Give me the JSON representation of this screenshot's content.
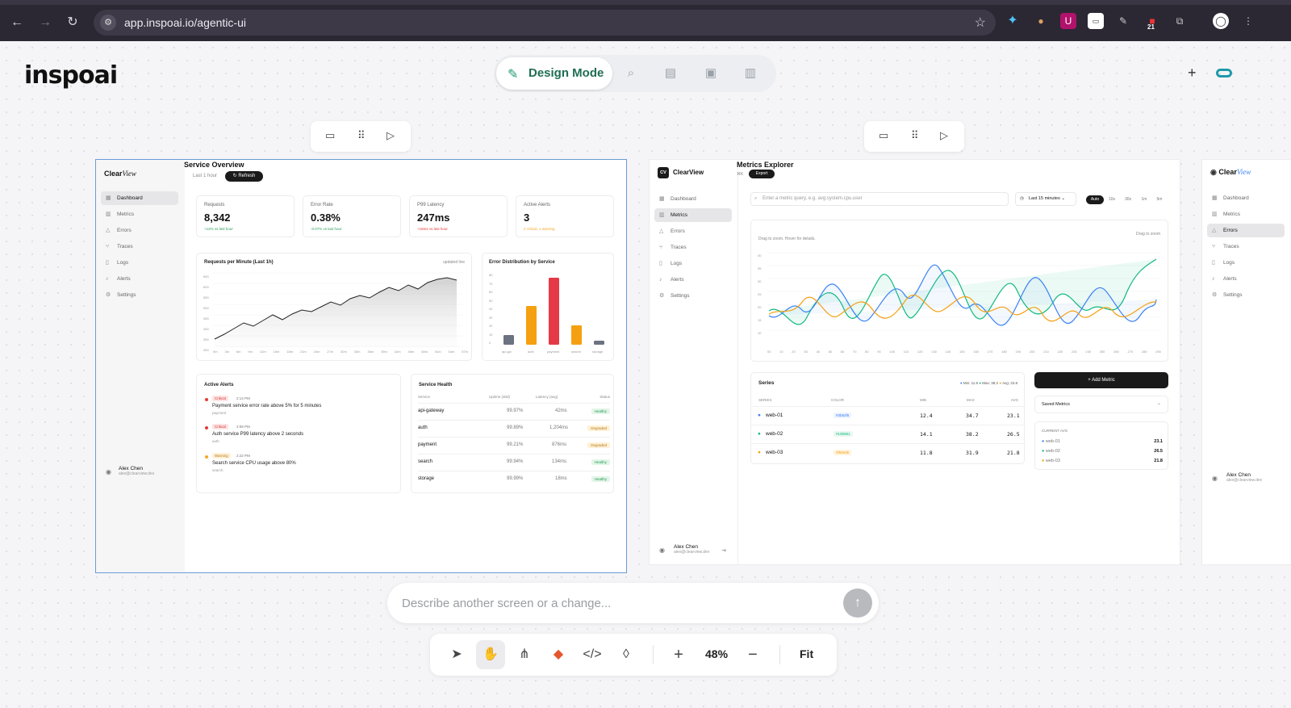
{
  "browser": {
    "url": "app.inspoai.io/agentic-ui",
    "extension_badge": "21"
  },
  "app": {
    "logo_text": "inspoai",
    "mode_label": "Design Mode",
    "mode_icons": [
      "search-icon",
      "layout-icon",
      "ai-icon",
      "trash-icon"
    ]
  },
  "colors": {
    "accent_green": "#1a9a6c",
    "selection_blue": "#6a9bd6",
    "critical": "#e53935",
    "warning": "#f5a623",
    "healthy": "#2e9e5b"
  },
  "screen1": {
    "brand": "Clear",
    "brand_italic": "View",
    "title": "Service Overview",
    "timerange": "Last 1 hour",
    "refresh_label": "Refresh",
    "nav": [
      "Dashboard",
      "Metrics",
      "Errors",
      "Traces",
      "Logs",
      "Alerts",
      "Settings"
    ],
    "kpis": [
      {
        "title": "Requests",
        "value": "8,342",
        "delta": "+12% vs last hour"
      },
      {
        "title": "Error Rate",
        "value": "0.38%",
        "delta": "-0.07% vs last hour"
      },
      {
        "title": "P99 Latency",
        "value": "247ms",
        "delta": "+18ms vs last hour"
      },
      {
        "title": "Active Alerts",
        "value": "3",
        "delta": "2 critical, 1 warning"
      }
    ],
    "rpm_chart": {
      "title": "Requests per Minute (Last 1h)",
      "badge": "updated live",
      "y_ticks": [
        "650",
        "600",
        "550",
        "500",
        "450",
        "400",
        "350",
        "300",
        "250"
      ],
      "x_ticks": [
        "0m",
        "3m",
        "6m",
        "9m",
        "12m",
        "15m",
        "18m",
        "21m",
        "24m",
        "27m",
        "30m",
        "33m",
        "36m",
        "39m",
        "42m",
        "45m",
        "48m",
        "51m",
        "54m",
        "57m"
      ]
    },
    "error_chart": {
      "title": "Error Distribution by Service",
      "y_ticks": [
        "80",
        "70",
        "60",
        "50",
        "40",
        "30",
        "20",
        "10",
        "0"
      ]
    },
    "alerts_title": "Active Alerts",
    "alerts": [
      {
        "severity": "Critical",
        "time": "2:14 PM",
        "message": "Payment service error rate above 5% for 5 minutes",
        "service": "payment"
      },
      {
        "severity": "Critical",
        "time": "2:08 PM",
        "message": "Auth service P99 latency above 2 seconds",
        "service": "auth"
      },
      {
        "severity": "Warning",
        "time": "2:22 PM",
        "message": "Search service CPU usage above 80%",
        "service": "search"
      }
    ],
    "health_title": "Service Health",
    "health_headers": [
      "Service",
      "Uptime (30d)",
      "Latency (avg)",
      "Status"
    ],
    "health_rows": [
      {
        "service": "api-gateway",
        "uptime": "99.97%",
        "latency": "42ms",
        "status": "Healthy"
      },
      {
        "service": "auth",
        "uptime": "99.89%",
        "latency": "1,204ms",
        "status": "Degraded"
      },
      {
        "service": "payment",
        "uptime": "99.21%",
        "latency": "876ms",
        "status": "Degraded"
      },
      {
        "service": "search",
        "uptime": "99.94%",
        "latency": "134ms",
        "status": "Healthy"
      },
      {
        "service": "storage",
        "uptime": "99.99%",
        "latency": "18ms",
        "status": "Healthy"
      }
    ],
    "user_name": "Alex Chen",
    "user_email": "alex@clearview.dev"
  },
  "screen2": {
    "brand_mark": "CV",
    "brand": "ClearView",
    "title": "Metrics Explorer",
    "shortcut": "⌘K",
    "export_label": "Export",
    "nav": [
      "Dashboard",
      "Metrics",
      "Errors",
      "Traces",
      "Logs",
      "Alerts",
      "Settings"
    ],
    "search_placeholder": "Enter a metric query, e.g. avg:system.cpu.user",
    "time_range": "Last 15 minutes",
    "refresh_chips": [
      "Auto",
      "10s",
      "30s",
      "1m",
      "5m"
    ],
    "chart_hint": "Drag to zoom. Hover for details.",
    "chart_action": "Drag to zoom",
    "y_ticks": [
      "40",
      "35",
      "30",
      "25",
      "20",
      "15",
      "10"
    ],
    "x_ticks": [
      "00",
      "10",
      "20",
      "30",
      "40",
      "50",
      "60",
      "70",
      "80",
      "90",
      "100",
      "110",
      "120",
      "130",
      "140",
      "150",
      "160",
      "170",
      "180",
      "190",
      "200",
      "210",
      "220",
      "230",
      "240",
      "250",
      "260",
      "270",
      "280",
      "290"
    ],
    "series_title": "Series",
    "series_summary": {
      "min": "Min: 11.8",
      "max": "Max: 38.2",
      "avg": "Avg: 23.8"
    },
    "series_headers": [
      "SERIES",
      "COLOR",
      "MIN",
      "MAX",
      "AVG"
    ],
    "series": [
      {
        "name": "web-01",
        "color": "#3b82f6",
        "min": "12.4",
        "max": "34.7",
        "avg": "23.1"
      },
      {
        "name": "web-02",
        "color": "#10b981",
        "min": "14.1",
        "max": "38.2",
        "avg": "26.5"
      },
      {
        "name": "web-03",
        "color": "#f59e0b",
        "min": "11.8",
        "max": "31.9",
        "avg": "21.8"
      }
    ],
    "add_metric_label": "Add Metric",
    "saved_metrics_label": "Saved Metrics",
    "current_avg_label": "CURRENT AVG",
    "user_name": "Alex Chen",
    "user_email": "alex@clearview.dev"
  },
  "screen3": {
    "brand": "Clear",
    "brand_italic": "View",
    "nav": [
      "Dashboard",
      "Metrics",
      "Errors",
      "Traces",
      "Logs",
      "Alerts",
      "Settings"
    ],
    "user_name": "Alex Chen",
    "user_email": "alex@clearview.dev"
  },
  "prompt": {
    "placeholder": "Describe another screen or a change..."
  },
  "dock": {
    "zoom": "48%",
    "fit_label": "Fit"
  }
}
